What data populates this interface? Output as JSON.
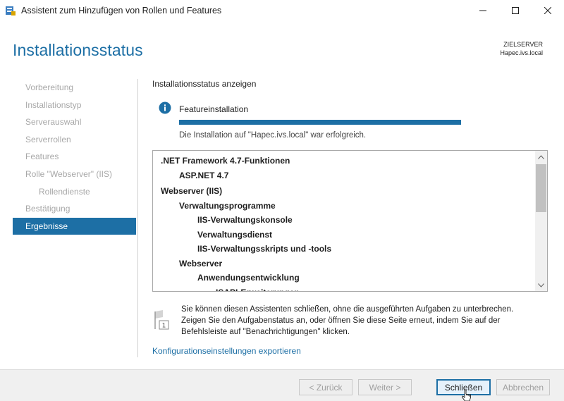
{
  "window": {
    "title": "Assistent zum Hinzufügen von Rollen und Features",
    "icon": "server-manager-icon"
  },
  "header": {
    "page_title": "Installationsstatus",
    "target_label": "ZIELSERVER",
    "target_server": "Hapec.ivs.local"
  },
  "sidebar": {
    "items": [
      {
        "label": "Vorbereitung",
        "state": "disabled"
      },
      {
        "label": "Installationstyp",
        "state": "disabled"
      },
      {
        "label": "Serverauswahl",
        "state": "disabled"
      },
      {
        "label": "Serverrollen",
        "state": "disabled"
      },
      {
        "label": "Features",
        "state": "disabled"
      },
      {
        "label": "Rolle \"Webserver\" (IIS)",
        "state": "disabled"
      },
      {
        "label": "Rollendienste",
        "state": "disabled"
      },
      {
        "label": "Bestätigung",
        "state": "disabled"
      },
      {
        "label": "Ergebnisse",
        "state": "active"
      }
    ]
  },
  "content": {
    "heading": "Installationsstatus anzeigen",
    "feature_label": "Featureinstallation",
    "progress_percent": 100,
    "status_message": "Die Installation auf \"Hapec.ivs.local\" war erfolgreich.",
    "installed_items": [
      {
        "label": ".NET Framework 4.7-Funktionen",
        "level": 0
      },
      {
        "label": "ASP.NET 4.7",
        "level": 1
      },
      {
        "label": "Webserver (IIS)",
        "level": 0
      },
      {
        "label": "Verwaltungsprogramme",
        "level": 1
      },
      {
        "label": "IIS-Verwaltungskonsole",
        "level": 2
      },
      {
        "label": "Verwaltungsdienst",
        "level": 2
      },
      {
        "label": "IIS-Verwaltungsskripts und -tools",
        "level": 2
      },
      {
        "label": "Webserver",
        "level": 1
      },
      {
        "label": "Anwendungsentwicklung",
        "level": 2
      },
      {
        "label": "ISAPI-Erweiterungen",
        "level": 3
      }
    ],
    "note_text": "Sie können diesen Assistenten schließen, ohne die ausgeführten Aufgaben zu unterbrechen. Zeigen Sie den Aufgabenstatus an, oder öffnen Sie diese Seite erneut, indem Sie auf der Befehlsleiste auf \"Benachrichtigungen\" klicken.",
    "note_badge": "1",
    "export_link": "Konfigurationseinstellungen exportieren"
  },
  "footer": {
    "back_label": "< Zurück",
    "next_label": "Weiter >",
    "close_label": "Schließen",
    "cancel_label": "Abbrechen"
  },
  "colors": {
    "accent": "#1d6fa5",
    "disabled_text": "#a8a8a8"
  }
}
